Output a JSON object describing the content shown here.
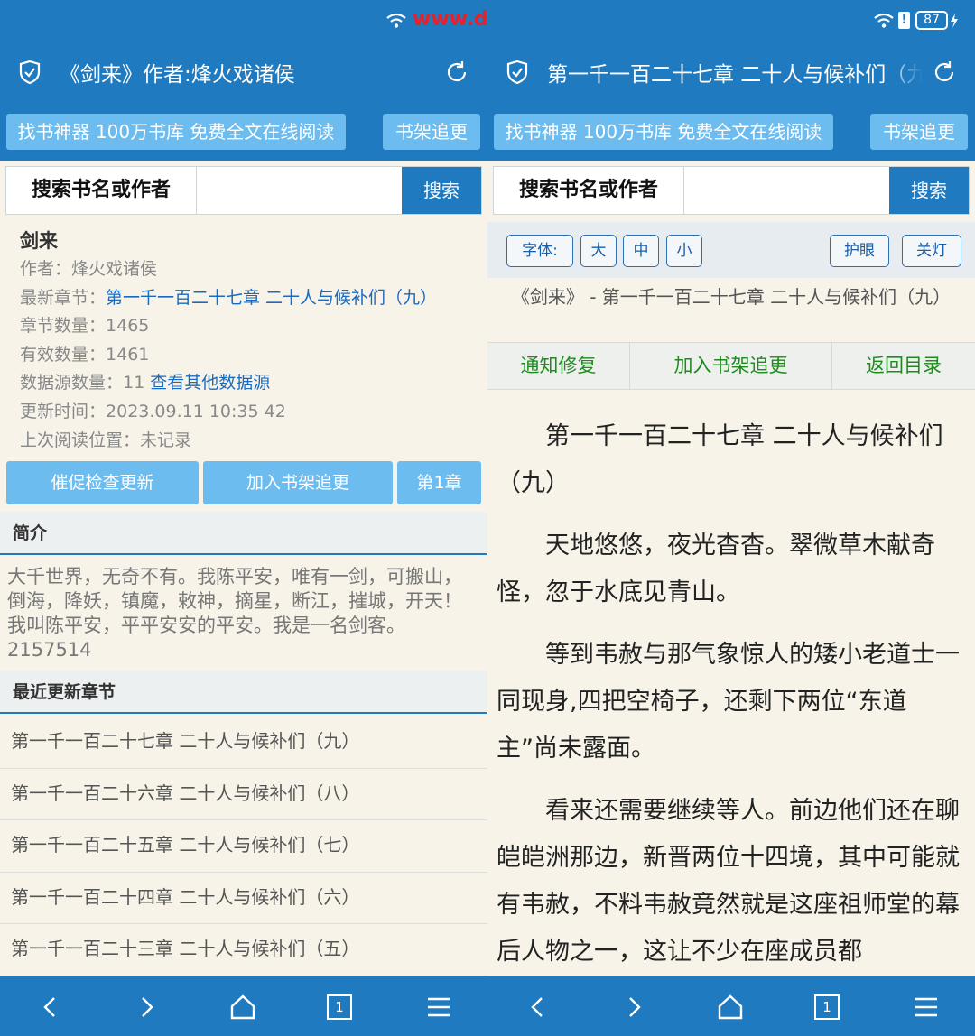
{
  "status": {
    "battery": "87",
    "watermark": "www.dgrai.com"
  },
  "left": {
    "appbar": {
      "title": "《剑来》作者:烽火戏诸侯",
      "shield_icon": "shield-check-icon",
      "refresh_icon": "refresh-icon"
    },
    "promo": {
      "main": "找书神器 100万书库 免费全文在线阅读",
      "shelf": "书架追更"
    },
    "search": {
      "label": "搜索书名或作者",
      "value": "",
      "button": "搜索"
    },
    "book": {
      "name": "剑来",
      "author_label": "作者：",
      "author": "烽火戏诸侯",
      "latest_label": "最新章节：",
      "latest": "第一千一百二十七章 二十人与候补们（九）",
      "count_label": "章节数量：",
      "count": "1465",
      "valid_label": "有效数量：",
      "valid": "1461",
      "sources_label": "数据源数量：",
      "sources": "11",
      "sources_link": "查看其他数据源",
      "updated_label": "更新时间：",
      "updated": "2023.09.11 10:35 42",
      "lastread_label": "上次阅读位置：",
      "lastread": "未记录"
    },
    "actions": {
      "urge": "催促检查更新",
      "add": "加入书架追更",
      "first": "第1章"
    },
    "intro_heading": "简介",
    "intro": "大千世界，无奇不有。我陈平安，唯有一剑，可搬山，倒海，降妖，镇魔，敕神，摘星，断江，摧城，开天！我叫陈平安，平平安安的平安。我是一名剑客。 2157514",
    "recent_heading": "最近更新章节",
    "chapters": [
      "第一千一百二十七章 二十人与候补们（九）",
      "第一千一百二十六章 二十人与候补们（八）",
      "第一千一百二十五章 二十人与候补们（七）",
      "第一千一百二十四章 二十人与候补们（六）",
      "第一千一百二十三章 二十人与候补们（五）"
    ]
  },
  "right": {
    "appbar": {
      "title": "第一千一百二十七章 二十人与候补们（九",
      "shield_icon": "shield-check-icon",
      "refresh_icon": "refresh-icon"
    },
    "promo": {
      "main": "找书神器 100万书库 免费全文在线阅读",
      "shelf": "书架追更"
    },
    "search": {
      "label": "搜索书名或作者",
      "value": "",
      "button": "搜索"
    },
    "toolbar": {
      "font": "字体:",
      "large": "大",
      "medium": "中",
      "small": "小",
      "eye": "护眼",
      "light": "关灯"
    },
    "chapter_title": "《剑来》 - 第一千一百二十七章 二十人与候补们（九）",
    "actions": {
      "notify": "通知修复",
      "add": "加入书架追更",
      "back": "返回目录"
    },
    "content": [
      "第一千一百二十七章 二十人与候补们（九）",
      "天地悠悠，夜光杳杳。翠微草木献奇怪，忽于水底见青山。",
      "等到韦赦与那气象惊人的矮小老道士一同现身,四把空椅子，还剩下两位“东道主”尚未露面。",
      "看来还需要继续等人。前边他们还在聊皑皑洲那边，新晋两位十四境，其中可能就有韦赦，不料韦赦竟然就是这座祖师堂的幕后人物之一，这让不少在座成员都"
    ]
  },
  "navbar": {
    "back": "back-icon",
    "forward": "forward-icon",
    "home": "home-icon",
    "tabs": "1",
    "menu": "menu-icon"
  },
  "colors": {
    "primary": "#1f7ac0",
    "button_light": "#6cbcf0",
    "page_bg": "#f7f3e8",
    "link": "#1a6bc0",
    "green": "#1f8a1f"
  }
}
